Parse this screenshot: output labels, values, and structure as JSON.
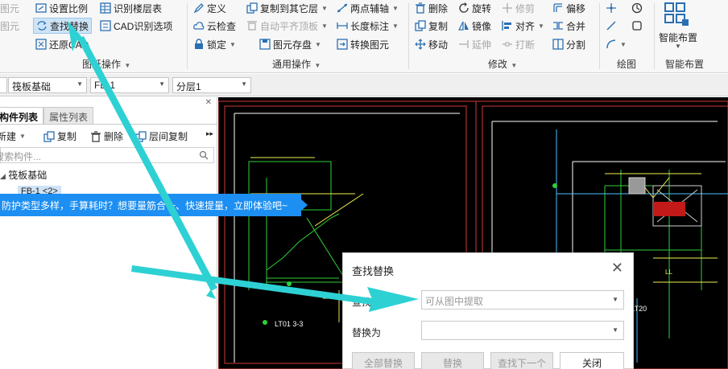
{
  "ribbon": {
    "buttons": [
      {
        "label": "图元",
        "icon": "layer-icon",
        "disabled": true
      },
      {
        "label": "设置比例",
        "icon": "scale-icon"
      },
      {
        "label": "识别楼层表",
        "icon": "floor-table-icon"
      },
      {
        "label": "定义",
        "icon": "define-icon"
      },
      {
        "label": "复制到其它层",
        "icon": "copy-layer-icon"
      },
      {
        "label": "两点辅轴",
        "icon": "axis-icon"
      },
      {
        "label": "删除",
        "icon": "delete-icon"
      },
      {
        "label": "旋转",
        "icon": "rotate-icon"
      },
      {
        "label": "修剪",
        "icon": "trim-icon",
        "disabled": true
      },
      {
        "label": "偏移",
        "icon": "offset-icon"
      },
      {
        "label": "图元",
        "icon": "layer-icon",
        "disabled": true
      },
      {
        "label": "查找替换",
        "icon": "find-replace-icon",
        "selected": true
      },
      {
        "label": "CAD识别选项",
        "icon": "cad-options-icon"
      },
      {
        "label": "云检查",
        "icon": "cloud-check-icon"
      },
      {
        "label": "自动平齐顶板",
        "icon": "align-top-icon",
        "disabled": true
      },
      {
        "label": "长度标注",
        "icon": "length-dim-icon"
      },
      {
        "label": "复制",
        "icon": "copy-icon"
      },
      {
        "label": "镜像",
        "icon": "mirror-icon"
      },
      {
        "label": "对齐",
        "icon": "align-icon"
      },
      {
        "label": "合并",
        "icon": "merge-icon"
      },
      {
        "label": "还原CAD",
        "icon": "restore-cad-icon"
      },
      {
        "label": "锁定",
        "icon": "lock-icon"
      },
      {
        "label": "图元存盘",
        "icon": "save-element-icon"
      },
      {
        "label": "转换图元",
        "icon": "convert-icon"
      },
      {
        "label": "移动",
        "icon": "move-icon"
      },
      {
        "label": "延伸",
        "icon": "extend-icon",
        "disabled": true
      },
      {
        "label": "打断",
        "icon": "break-icon",
        "disabled": true
      },
      {
        "label": "分割",
        "icon": "split-icon"
      }
    ],
    "groups": {
      "element_ops": "图纸操作",
      "common_ops": "通用操作",
      "modify": "修改",
      "draw": "绘图",
      "smart_layout_title": "智能布置",
      "smart_layout_label": "智能布置"
    }
  },
  "selectors": {
    "category": "筏板基础",
    "component": "FB-1",
    "layer": "分层1"
  },
  "panel": {
    "tabs": [
      "构件列表",
      "属性列表"
    ],
    "tools": [
      "新建",
      "复制",
      "删除",
      "层间复制"
    ],
    "search_placeholder": "搜索构件...",
    "tree_root": "筏板基础",
    "tree_child": "FB-1 <2>"
  },
  "banner": {
    "text": "防护类型多样，手算耗时？想要量筋合一、快速提量，立即体验吧~"
  },
  "cad": {
    "labels": [
      "LT01  3-3",
      "LT19,LT20",
      "LL"
    ]
  },
  "dialog": {
    "title": "查找替换",
    "find_label": "查找内容",
    "find_placeholder": "可从图中提取",
    "replace_label": "替换为",
    "replace_value": "",
    "btn_replace_all": "全部替换",
    "btn_replace": "替换",
    "btn_find_next": "查找下一个",
    "btn_close": "关闭"
  },
  "colors": {
    "accent": "#1d8ff2",
    "arrow": "#2ed1d3",
    "cad_bg": "#000000"
  }
}
